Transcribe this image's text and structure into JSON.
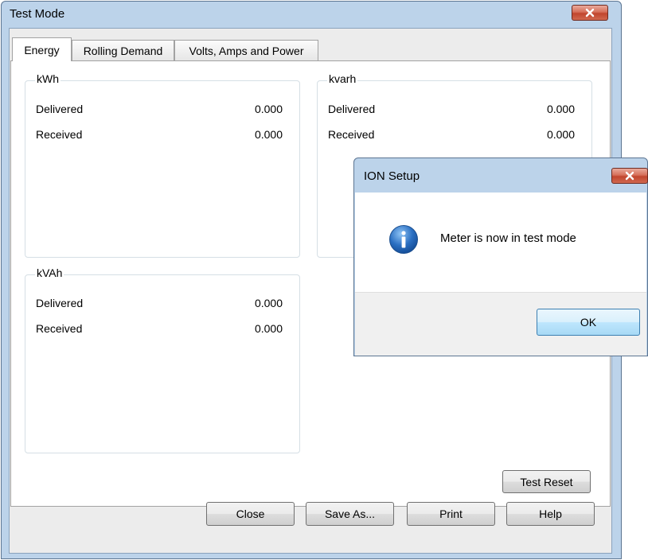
{
  "window": {
    "title": "Test Mode"
  },
  "tabs": [
    {
      "label": "Energy",
      "active": true
    },
    {
      "label": "Rolling Demand",
      "active": false
    },
    {
      "label": "Volts, Amps and Power",
      "active": false
    }
  ],
  "groups": {
    "kwh": {
      "title": "kWh",
      "rows": [
        {
          "label": "Delivered",
          "value": "0.000"
        },
        {
          "label": "Received",
          "value": "0.000"
        }
      ]
    },
    "kvarh": {
      "title": "kvarh",
      "rows": [
        {
          "label": "Delivered",
          "value": "0.000"
        },
        {
          "label": "Received",
          "value": "0.000"
        }
      ]
    },
    "kvah": {
      "title": "kVAh",
      "rows": [
        {
          "label": "Delivered",
          "value": "0.000"
        },
        {
          "label": "Received",
          "value": "0.000"
        }
      ]
    }
  },
  "buttons": {
    "test_reset": "Test Reset",
    "close": "Close",
    "save_as": "Save As...",
    "print": "Print",
    "help": "Help"
  },
  "dialog": {
    "title": "ION Setup",
    "icon": "info-icon",
    "message": "Meter is now in test mode",
    "ok": "OK"
  },
  "colors": {
    "frame": "#bcd3ea",
    "close_button": "#c7503a",
    "info_icon": "#2a6fc2",
    "ok_border": "#3c7fb1"
  }
}
